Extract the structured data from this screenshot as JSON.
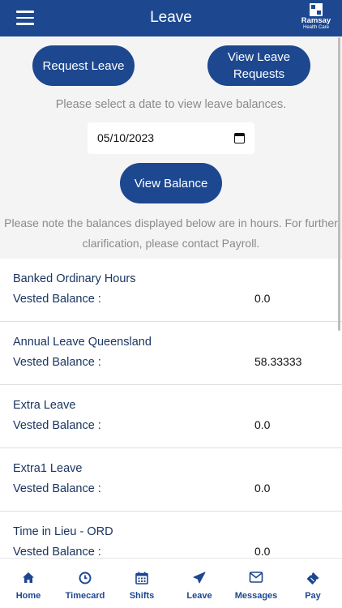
{
  "header": {
    "title": "Leave",
    "menu_icon": "hamburger-menu-icon",
    "logo": {
      "name": "Ramsay",
      "sub": "Health Care"
    }
  },
  "actions": {
    "request_leave": "Request Leave",
    "view_leave_requests": "View Leave Requests",
    "view_balance": "View Balance"
  },
  "date_select": {
    "instruction": "Please select a date to view leave balances.",
    "value": "05/10/2023"
  },
  "note": {
    "line1": "Please note the balances displayed below are in hours. For further",
    "line2": "clarification, please contact Payroll."
  },
  "balances": [
    {
      "type": "Banked Ordinary Hours",
      "label": "Vested Balance :",
      "value": "0.0"
    },
    {
      "type": "Annual Leave Queensland",
      "label": "Vested Balance :",
      "value": "58.33333"
    },
    {
      "type": "Extra Leave",
      "label": "Vested Balance :",
      "value": "0.0"
    },
    {
      "type": "Extra1 Leave",
      "label": "Vested Balance :",
      "value": "0.0"
    },
    {
      "type": "Time in Lieu - ORD",
      "label": "Vested Balance :",
      "value": "0.0"
    }
  ],
  "nav": [
    {
      "label": "Home",
      "icon": "home-icon"
    },
    {
      "label": "Timecard",
      "icon": "clock-icon"
    },
    {
      "label": "Shifts",
      "icon": "calendar-icon"
    },
    {
      "label": "Leave",
      "icon": "airplane-icon"
    },
    {
      "label": "Messages",
      "icon": "envelope-icon"
    },
    {
      "label": "Pay",
      "icon": "ticket-icon"
    }
  ],
  "colors": {
    "primary": "#1d4890",
    "background": "#f4f4f4",
    "muted_text": "#8a8a8a",
    "row_text": "#1a3561"
  }
}
